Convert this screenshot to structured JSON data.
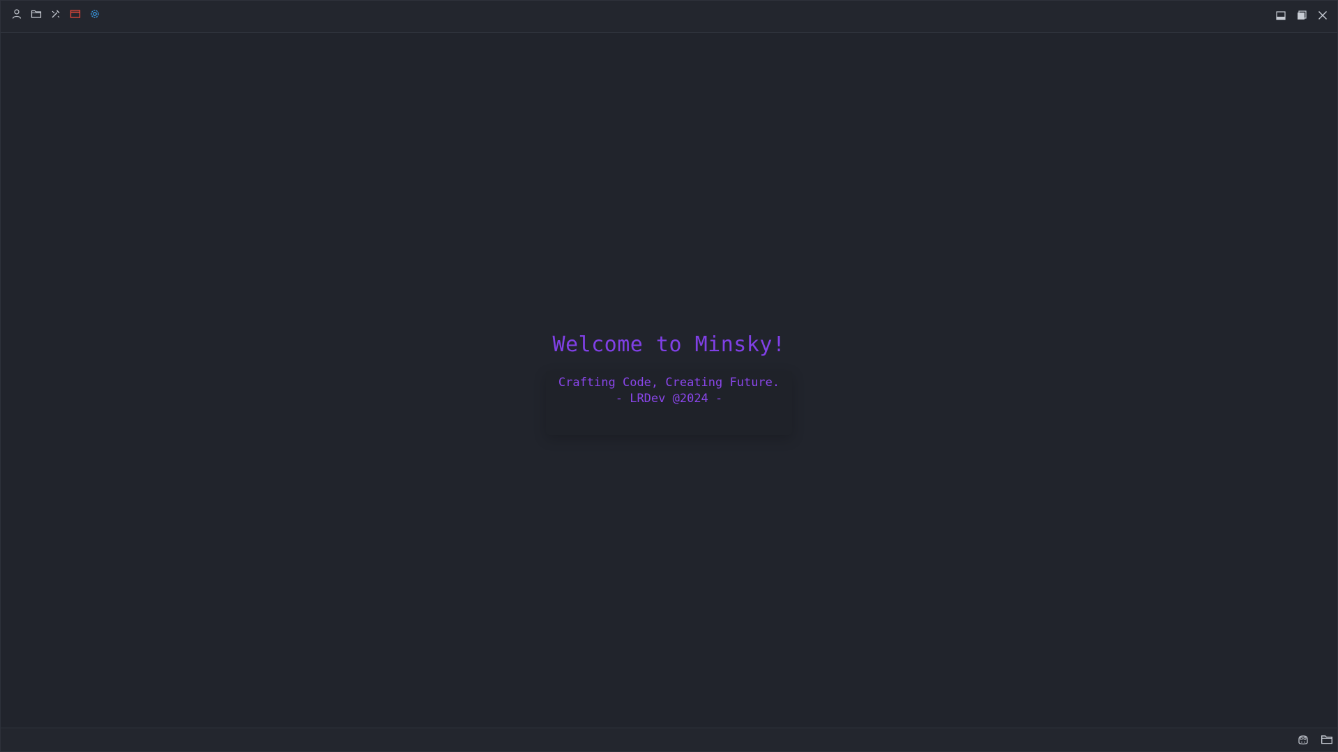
{
  "titlebar": {
    "icons": [
      "user-icon",
      "folder-icon",
      "tools-icon",
      "window-icon",
      "settings-icon"
    ],
    "window_controls": [
      "minimize-icon",
      "maximize-icon",
      "close-icon"
    ]
  },
  "welcome": {
    "title": "Welcome to Minsky!",
    "tagline": "Crafting Code, Creating Future.",
    "signature": "- LRDev @2024 -"
  },
  "statusbar": {
    "icons": [
      "copilot-icon",
      "folder-icon"
    ]
  },
  "colors": {
    "background": "#21242c",
    "accent": "#8040e6",
    "window_icon": "#e0473a",
    "settings_icon": "#3b9ee8",
    "icon_default": "#c8ccd4"
  }
}
